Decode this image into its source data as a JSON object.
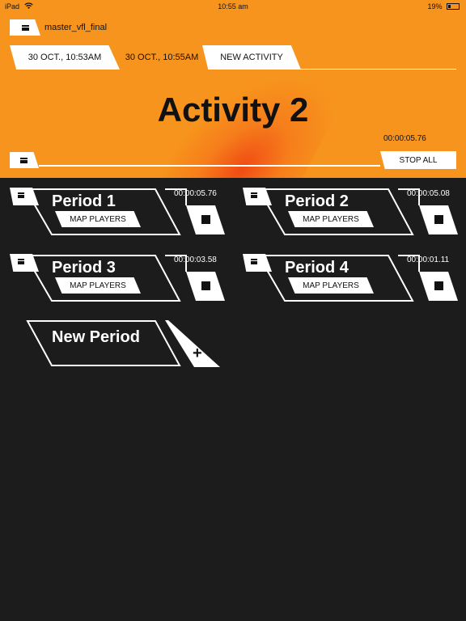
{
  "status_bar": {
    "device": "iPad",
    "wifi_icon": "wifi-icon",
    "time": "10:55 am",
    "battery": "19%"
  },
  "header": {
    "project_name": "master_vfl_final",
    "tabs": [
      {
        "label": "30 OCT., 10:53AM",
        "active": false
      },
      {
        "label": "30 OCT., 10:55AM",
        "active": true
      },
      {
        "label": "NEW ACTIVITY",
        "active": false
      }
    ],
    "activity_title": "Activity 2",
    "activity_timer": "00:00:05.76",
    "stop_all_label": "STOP ALL"
  },
  "periods": [
    {
      "name": "Period 1",
      "map_label": "MAP PLAYERS",
      "timer": "00:00:05.76"
    },
    {
      "name": "Period 2",
      "map_label": "MAP PLAYERS",
      "timer": "00:00:05.08"
    },
    {
      "name": "Period 3",
      "map_label": "MAP PLAYERS",
      "timer": "00:00:03.58"
    },
    {
      "name": "Period 4",
      "map_label": "MAP PLAYERS",
      "timer": "00:00:01.11"
    }
  ],
  "new_period": {
    "label": "New Period",
    "add_icon": "plus-icon"
  },
  "colors": {
    "accent": "#f7941d",
    "background": "#1c1c1c",
    "glow": "#f04614"
  }
}
